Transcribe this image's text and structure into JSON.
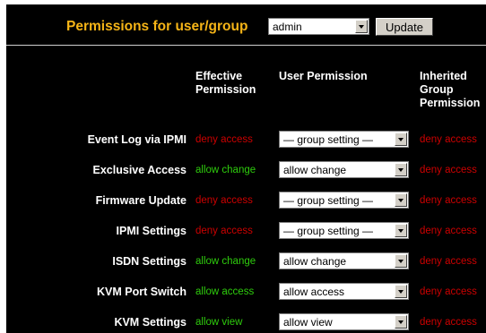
{
  "header": {
    "title": "Permissions for user/group",
    "user_select_value": "admin",
    "update_label": "Update"
  },
  "columns": {
    "effective": "Effective Permission",
    "user": "User Permission",
    "inherited": "Inherited Group Permission"
  },
  "colors": {
    "deny": "#cc0000",
    "allow": "#2ecc0d",
    "title": "#f5b417"
  },
  "rows": [
    {
      "label": "Event Log via IPMI",
      "effective": "deny access",
      "effective_state": "deny",
      "user_permission": "— group setting —",
      "inherited": "deny access"
    },
    {
      "label": "Exclusive Access",
      "effective": "allow change",
      "effective_state": "allow",
      "user_permission": "allow change",
      "inherited": "deny access"
    },
    {
      "label": "Firmware Update",
      "effective": "deny access",
      "effective_state": "deny",
      "user_permission": "— group setting —",
      "inherited": "deny access"
    },
    {
      "label": "IPMI Settings",
      "effective": "deny access",
      "effective_state": "deny",
      "user_permission": "— group setting —",
      "inherited": "deny access"
    },
    {
      "label": "ISDN Settings",
      "effective": "allow change",
      "effective_state": "allow",
      "user_permission": "allow change",
      "inherited": "deny access"
    },
    {
      "label": "KVM Port Switch",
      "effective": "allow access",
      "effective_state": "allow",
      "user_permission": "allow access",
      "inherited": "deny access"
    },
    {
      "label": "KVM Settings",
      "effective": "allow view",
      "effective_state": "allow",
      "user_permission": "allow view",
      "inherited": "deny access"
    }
  ]
}
